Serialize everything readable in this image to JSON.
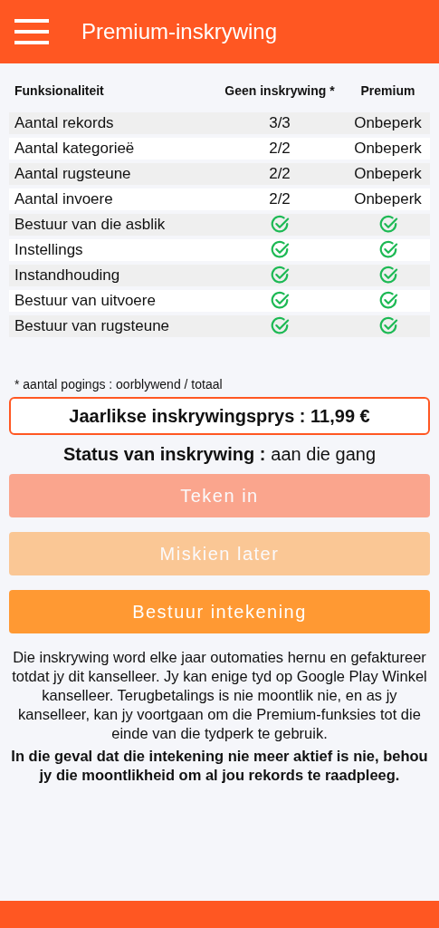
{
  "app_bar": {
    "title": "Premium-inskrywing"
  },
  "table": {
    "columns": [
      "Funksionaliteit",
      "Geen inskrywing *",
      "Premium"
    ],
    "rows": [
      {
        "feature": "Aantal rekords",
        "free": {
          "kind": "text",
          "text": "3/3"
        },
        "premium": {
          "kind": "text",
          "text": "Onbeperk"
        }
      },
      {
        "feature": "Aantal kategorieë",
        "free": {
          "kind": "text",
          "text": "2/2"
        },
        "premium": {
          "kind": "text",
          "text": "Onbeperk"
        }
      },
      {
        "feature": "Aantal rugsteune",
        "free": {
          "kind": "text",
          "text": "2/2"
        },
        "premium": {
          "kind": "text",
          "text": "Onbeperk"
        }
      },
      {
        "feature": "Aantal invoere",
        "free": {
          "kind": "text",
          "text": "2/2"
        },
        "premium": {
          "kind": "text",
          "text": "Onbeperk"
        }
      },
      {
        "feature": "Bestuur van die asblik",
        "free": {
          "kind": "check"
        },
        "premium": {
          "kind": "check"
        }
      },
      {
        "feature": "Instellings",
        "free": {
          "kind": "check"
        },
        "premium": {
          "kind": "check"
        }
      },
      {
        "feature": "Instandhouding",
        "free": {
          "kind": "check"
        },
        "premium": {
          "kind": "check"
        }
      },
      {
        "feature": "Bestuur van uitvoere",
        "free": {
          "kind": "check"
        },
        "premium": {
          "kind": "check"
        }
      },
      {
        "feature": "Bestuur van rugsteune",
        "free": {
          "kind": "check"
        },
        "premium": {
          "kind": "check"
        }
      }
    ]
  },
  "footnote": "* aantal pogings : oorblywend / totaal",
  "price": "Jaarlikse inskrywingsprys : 11,99 €",
  "status": {
    "label": "Status van inskrywing :",
    "value": "aan die gang"
  },
  "buttons": [
    {
      "label": "Teken in",
      "kind": "primary",
      "disabled": true
    },
    {
      "label": "Miskien later",
      "kind": "secondary",
      "disabled": true
    },
    {
      "label": "Bestuur intekening",
      "kind": "manage",
      "disabled": false
    }
  ],
  "notice": "Die inskrywing word elke jaar outomaties hernu en gefaktureer totdat jy dit kanselleer. Jy kan enige tyd op Google Play Winkel kanselleer. Terugbetalings is nie moontlik nie, en as jy kanselleer, kan jy voortgaan om die Premium-funksies tot die einde van die tydperk te gebruik.",
  "notice_bold": "In die geval dat die intekening nie meer aktief is nie, behou jy die moontlikheid om al jou rekords te raadpleeg."
}
